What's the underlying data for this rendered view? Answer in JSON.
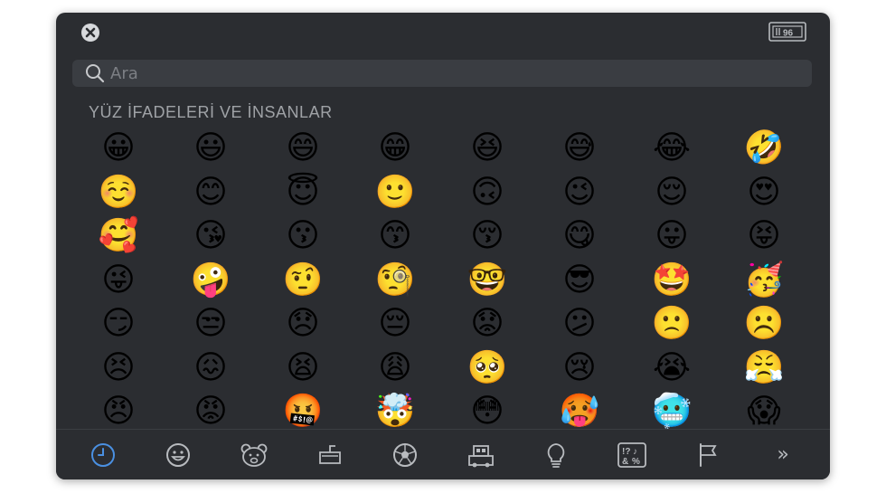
{
  "search": {
    "placeholder": "Ara"
  },
  "section": {
    "title": "YÜZ İFADELERİ VE İNSANLAR"
  },
  "emojis": [
    [
      "😀",
      "😃",
      "😄",
      "😁",
      "😆",
      "😅",
      "😂",
      "🤣"
    ],
    [
      "☺️",
      "😊",
      "😇",
      "🙂",
      "🙃",
      "😉",
      "😌",
      "😍"
    ],
    [
      "🥰",
      "😘",
      "😗",
      "😙",
      "😚",
      "😋",
      "😛",
      "😝"
    ],
    [
      "😜",
      "🤪",
      "🤨",
      "🧐",
      "🤓",
      "😎",
      "🤩",
      "🥳"
    ],
    [
      "😏",
      "😒",
      "😞",
      "😔",
      "😟",
      "😕",
      "🙁",
      "☹️"
    ],
    [
      "😣",
      "😖",
      "😫",
      "😩",
      "🥺",
      "😢",
      "😭",
      "😤"
    ],
    [
      "😠",
      "😡",
      "🤬",
      "🤯",
      "😳",
      "🥵",
      "🥶",
      "😱"
    ]
  ],
  "tabbar": {
    "active": "recent",
    "more_label": "»",
    "tabs": [
      "recent",
      "smileys",
      "animals",
      "food",
      "activity",
      "travel",
      "objects",
      "symbols",
      "flags"
    ]
  },
  "colors": {
    "panel": "#2b2d31",
    "accent": "#4a90e2",
    "search_bg": "#3a3d42",
    "icon": "#b8bbbf"
  }
}
